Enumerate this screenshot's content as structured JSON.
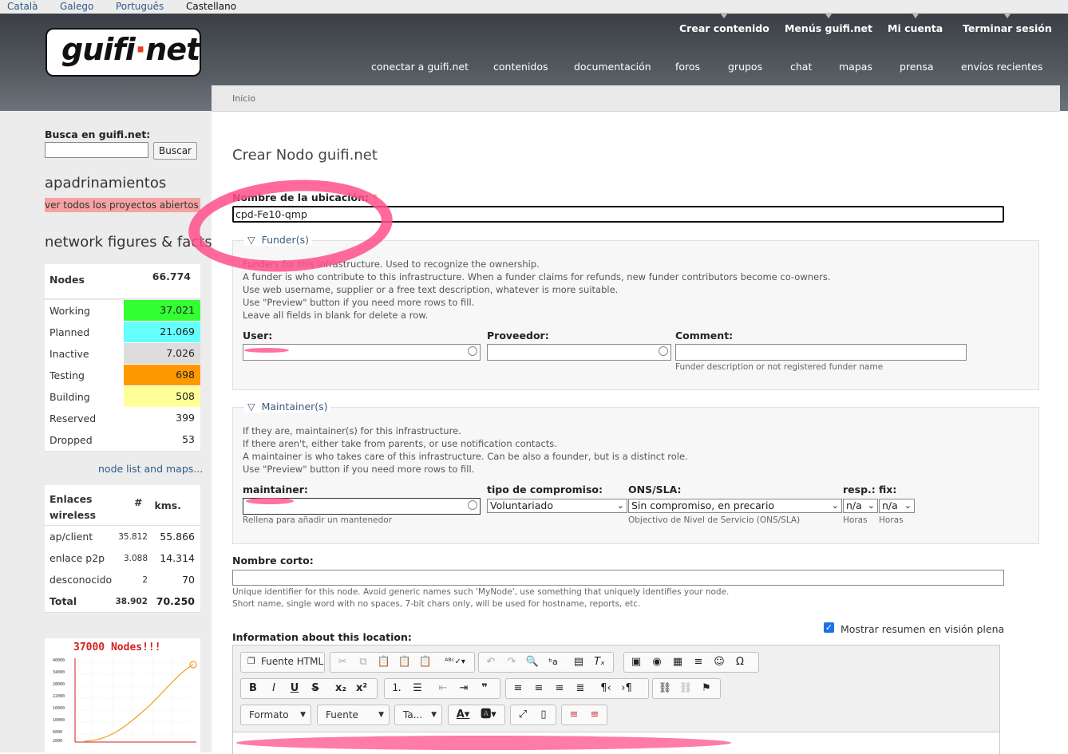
{
  "langbar": [
    "Català",
    "Galego",
    "Português",
    "Castellano"
  ],
  "logo": {
    "text_a": "guifi",
    "dot": "·",
    "text_b": "net"
  },
  "topnav": [
    "Crear contenido",
    "Menús guifi.net",
    "Mi cuenta",
    "Terminar sesión"
  ],
  "mainnav": [
    "conectar a guifi.net",
    "contenidos",
    "documentación",
    "foros",
    "grupos",
    "chat",
    "mapas",
    "prensa",
    "envíos recientes"
  ],
  "sidebar": {
    "search_label": "Busca en guifi.net:",
    "search_button": "Buscar",
    "sponsor_heading": "apadrinamientos",
    "sponsor_link": "ver todos los proyectos abiertos",
    "figures_heading": "network figures & facts",
    "nodes_label": "Nodes",
    "nodes_total": "66.774",
    "node_rows": [
      {
        "label": "Working",
        "value": "37.021",
        "color": "#33ff33"
      },
      {
        "label": "Planned",
        "value": "21.069",
        "color": "#66ffff"
      },
      {
        "label": "Inactive",
        "value": "7.026",
        "color": "#dddddd"
      },
      {
        "label": "Testing",
        "value": "698",
        "color": "#ff9900"
      },
      {
        "label": "Building",
        "value": "508",
        "color": "#ffff99"
      },
      {
        "label": "Reserved",
        "value": "399",
        "color": "#ffffff"
      },
      {
        "label": "Dropped",
        "value": "53",
        "color": "#ffffff"
      }
    ],
    "node_list_link": "node list and maps...",
    "links_header": {
      "label": "Enlaces wireless",
      "count": "#",
      "kms": "kms."
    },
    "link_rows": [
      {
        "label": "ap/client",
        "count": "35.812",
        "kms": "55.866"
      },
      {
        "label": "enlace p2p",
        "count": "3.088",
        "kms": "14.314"
      },
      {
        "label": "desconocido",
        "count": "2",
        "kms": "70"
      },
      {
        "label": "Total",
        "count": "38.902",
        "kms": "70.250"
      }
    ],
    "chart_title": "37000 Nodes!!!"
  },
  "breadcrumb": "Inicio",
  "page_title": "Crear Nodo guifi.net",
  "form": {
    "location_label": "Nombre de la ubicación:",
    "required_mark": "*",
    "location_value": "cpd-Fe10-qmp",
    "funders": {
      "legend": "Funder(s)",
      "desc": [
        "Funders for this infrastructure. Used to recognize the ownership.",
        "A funder is who contribute to this infrastructure. When a funder claims for refunds, new funder contributors become co-owners.",
        "Use web username, supplier or a free text description, whatever is more suitable.",
        "Use \"Preview\" button if you need more rows to fill.",
        "Leave all fields in blank for delete a row."
      ],
      "user_label": "User:",
      "supplier_label": "Proveedor:",
      "comment_label": "Comment:",
      "comment_hint": "Funder description or not registered funder name"
    },
    "maintainers": {
      "legend": "Maintainer(s)",
      "desc": [
        "If they are, maintainer(s) for this infrastructure.",
        "If there aren't, either take from parents, or use notification contacts.",
        "A maintainer is who takes care of this infrastructure. Can be also a founder, but is a distinct role.",
        "Use \"Preview\" button if you need more rows to fill."
      ],
      "maintainer_label": "maintainer:",
      "maintainer_hint": "Rellena para añadir un mantenedor",
      "commitment_label": "tipo de compromiso:",
      "commitment_value": "Voluntariado",
      "sla_label": "ONS/SLA:",
      "sla_value": "Sin compromiso, en precario",
      "sla_hint": "Objectivo de Nivel de Servicio (ONS/SLA)",
      "resp_label": "resp.:",
      "resp_value": "n/a",
      "resp_hint": "Horas",
      "fix_label": "fix:",
      "fix_value": "n/a",
      "fix_hint": "Horas"
    },
    "short_name_label": "Nombre corto:",
    "short_name_hint_1": "Unique identifier for this node. Avoid generic names such 'MyNode', use something that uniquely identifies your node.",
    "short_name_hint_2": "Short name, single word with no spaces, 7-bit chars only, will be used for hostname, reports, etc.",
    "summary_checkbox": "Mostrar resumen en visión plena",
    "info_label": "Information about this location:"
  },
  "editor": {
    "source_button": "Fuente HTML",
    "format_combo": "Formato",
    "font_combo": "Fuente",
    "size_combo": "Ta..."
  },
  "colors": {
    "header": "#4a4f56",
    "sidebar": "#ececec",
    "highlight": "#f5a3a3",
    "scribble": "#ff4f8b"
  }
}
